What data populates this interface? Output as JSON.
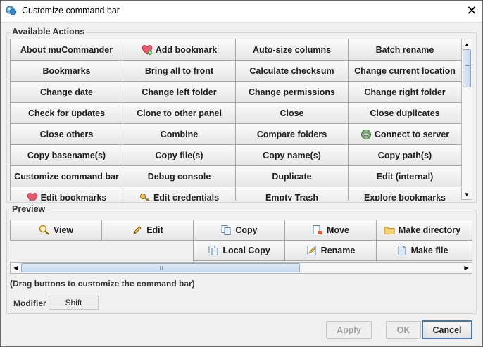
{
  "window": {
    "title": "Customize command bar",
    "close_glyph": "✕"
  },
  "available_actions": {
    "legend": "Available Actions",
    "rows": [
      [
        {
          "label": "About muCommander"
        },
        {
          "label": "Add bookmark",
          "icon": "heart-add-icon"
        },
        {
          "label": "Auto-size columns"
        },
        {
          "label": "Batch rename"
        }
      ],
      [
        {
          "label": "Bookmarks"
        },
        {
          "label": "Bring all to front"
        },
        {
          "label": "Calculate checksum"
        },
        {
          "label": "Change current location"
        }
      ],
      [
        {
          "label": "Change date"
        },
        {
          "label": "Change left folder"
        },
        {
          "label": "Change permissions"
        },
        {
          "label": "Change right folder"
        }
      ],
      [
        {
          "label": "Check for updates"
        },
        {
          "label": "Clone to other panel"
        },
        {
          "label": "Close"
        },
        {
          "label": "Close duplicates"
        }
      ],
      [
        {
          "label": "Close others"
        },
        {
          "label": "Combine"
        },
        {
          "label": "Compare folders"
        },
        {
          "label": "Connect to server",
          "icon": "server-icon"
        }
      ],
      [
        {
          "label": "Copy basename(s)"
        },
        {
          "label": "Copy file(s)"
        },
        {
          "label": "Copy name(s)"
        },
        {
          "label": "Copy path(s)"
        }
      ],
      [
        {
          "label": "Customize command bar"
        },
        {
          "label": "Debug console"
        },
        {
          "label": "Duplicate"
        },
        {
          "label": "Edit (internal)"
        }
      ],
      [
        {
          "label": "Edit bookmarks",
          "icon": "heart-icon"
        },
        {
          "label": "Edit credentials",
          "icon": "key-icon"
        },
        {
          "label": "Empty Trash"
        },
        {
          "label": "Explore bookmarks"
        }
      ]
    ]
  },
  "preview": {
    "legend": "Preview",
    "buttons": [
      {
        "label": "View",
        "icon": "magnifier-icon"
      },
      {
        "label": "Edit",
        "icon": "pencil-icon"
      },
      {
        "label": "Copy",
        "icon": "copy-icon"
      },
      {
        "label": "Move",
        "icon": "move-icon"
      },
      {
        "label": "Make directory",
        "icon": "folder-icon"
      },
      {
        "label": "Local Copy",
        "icon": "local-copy-icon"
      },
      {
        "label": "Rename",
        "icon": "rename-icon"
      },
      {
        "label": "Make file",
        "icon": "file-icon"
      }
    ],
    "hint": "(Drag buttons to customize the command bar)",
    "modifier_label": "Modifier",
    "modifier_value": "Shift"
  },
  "footer": {
    "apply_label": "Apply",
    "ok_label": "OK",
    "cancel_label": "Cancel"
  },
  "colors": {
    "dialog_background": "#f0f0f0",
    "button_border": "#a7a7a7",
    "default_button_border": "#4a77b4",
    "scroll_thumb": "#c9d9ee"
  }
}
